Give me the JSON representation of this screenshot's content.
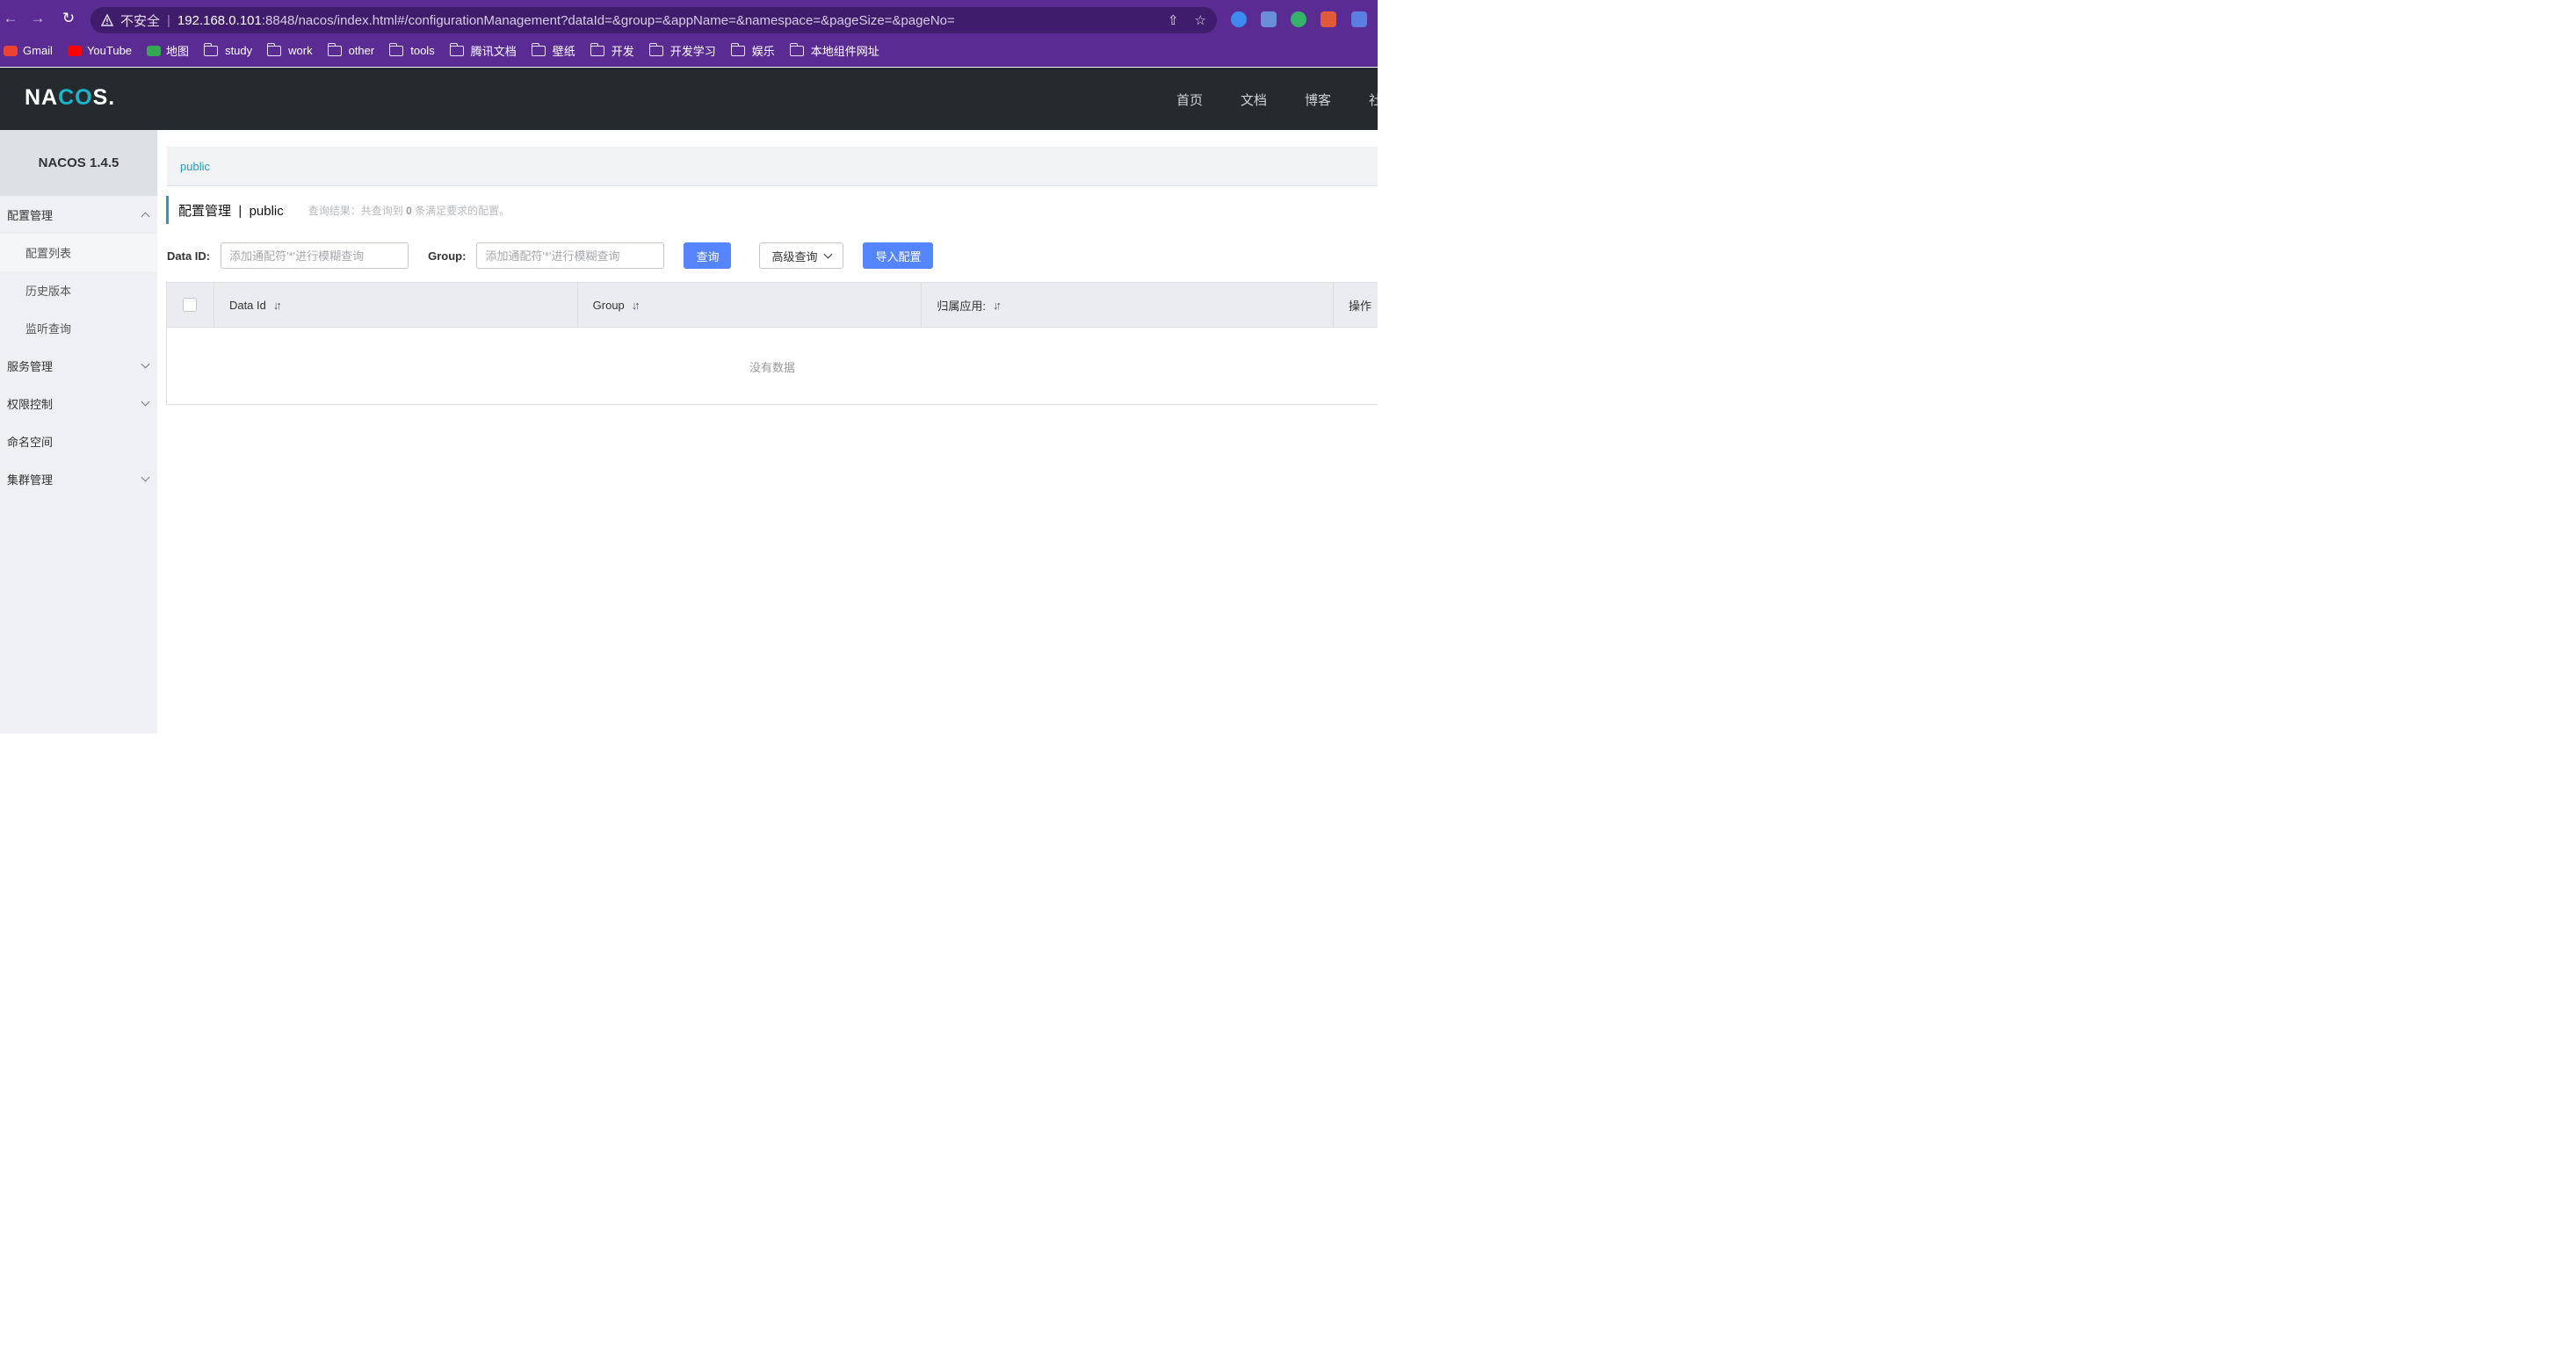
{
  "browser": {
    "insecure_label": "不安全",
    "url_host": "192.168.0.101",
    "url_path": ":8848/nacos/index.html#/configurationManagement?dataId=&group=&appName=&namespace=&pageSize=&pageNo=",
    "bookmarks": [
      "Gmail",
      "YouTube",
      "地图",
      "study",
      "work",
      "other",
      "tools",
      "腾讯文档",
      "壁纸",
      "开发",
      "开发学习",
      "娱乐",
      "本地组件网址"
    ]
  },
  "header": {
    "logo_left": "NA",
    "logo_co": "CO",
    "logo_right": "S.",
    "nav": [
      "首页",
      "文档",
      "博客",
      "社"
    ]
  },
  "sidebar": {
    "version": "NACOS 1.4.5",
    "config_mgmt": "配置管理",
    "config_list": "配置列表",
    "history": "历史版本",
    "listen_query": "监听查询",
    "service_mgmt": "服务管理",
    "auth_ctrl": "权限控制",
    "namespace": "命名空间",
    "cluster_mgmt": "集群管理"
  },
  "main": {
    "namespace_tab": "public",
    "title": "配置管理  |  public",
    "result_prefix": "查询结果：共查询到 ",
    "result_count": "0",
    "result_suffix": " 条满足要求的配置。",
    "dataid_label": "Data ID:",
    "dataid_placeholder": "添加通配符'*'进行模糊查询",
    "group_label": "Group:",
    "group_placeholder": "添加通配符'*'进行模糊查询",
    "query_btn": "查询",
    "advanced_btn": "高级查询",
    "import_btn": "导入配置",
    "columns": [
      "Data Id",
      "Group",
      "归属应用:",
      "操作"
    ],
    "empty_text": "没有数据"
  }
}
